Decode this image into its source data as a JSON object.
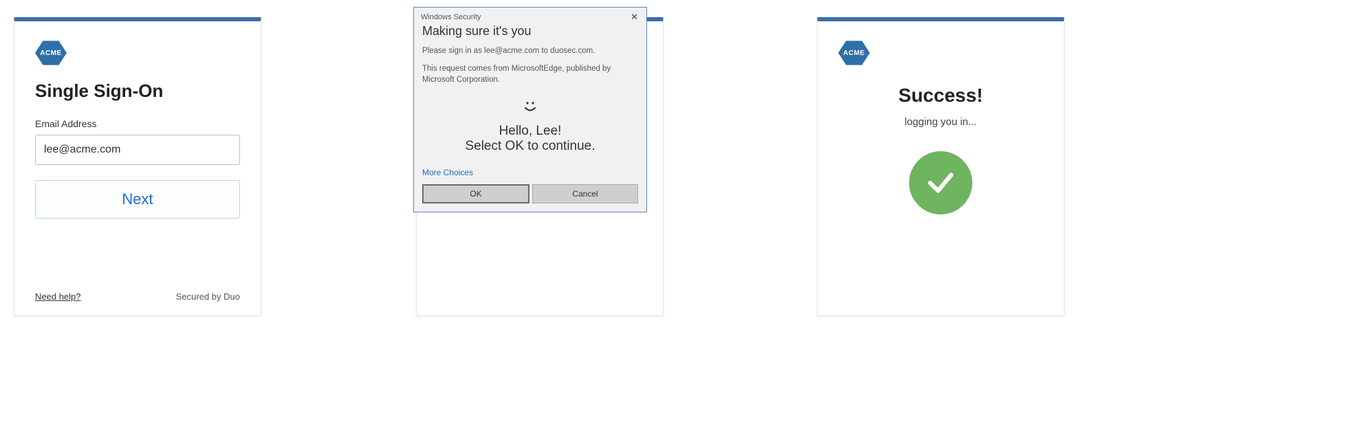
{
  "brand": {
    "name": "ACME"
  },
  "panel1": {
    "title": "Single Sign-On",
    "email_label": "Email Address",
    "email_value": "lee@acme.com",
    "next_label": "Next",
    "help_link": "Need help?",
    "secured_by": "Secured by Duo"
  },
  "winsec": {
    "titlebar": "Windows Security",
    "heading": "Making sure it's you",
    "line1": "Please sign in as lee@acme.com to duosec.com.",
    "line2": "This request comes from MicrosoftEdge, published by Microsoft Corporation.",
    "smiley": "︶",
    "hello": "Hello, Lee!",
    "select": "Select OK to continue.",
    "more": "More Choices",
    "ok": "OK",
    "cancel": "Cancel"
  },
  "panel3": {
    "title": "Success!",
    "subtitle": "logging you in..."
  }
}
